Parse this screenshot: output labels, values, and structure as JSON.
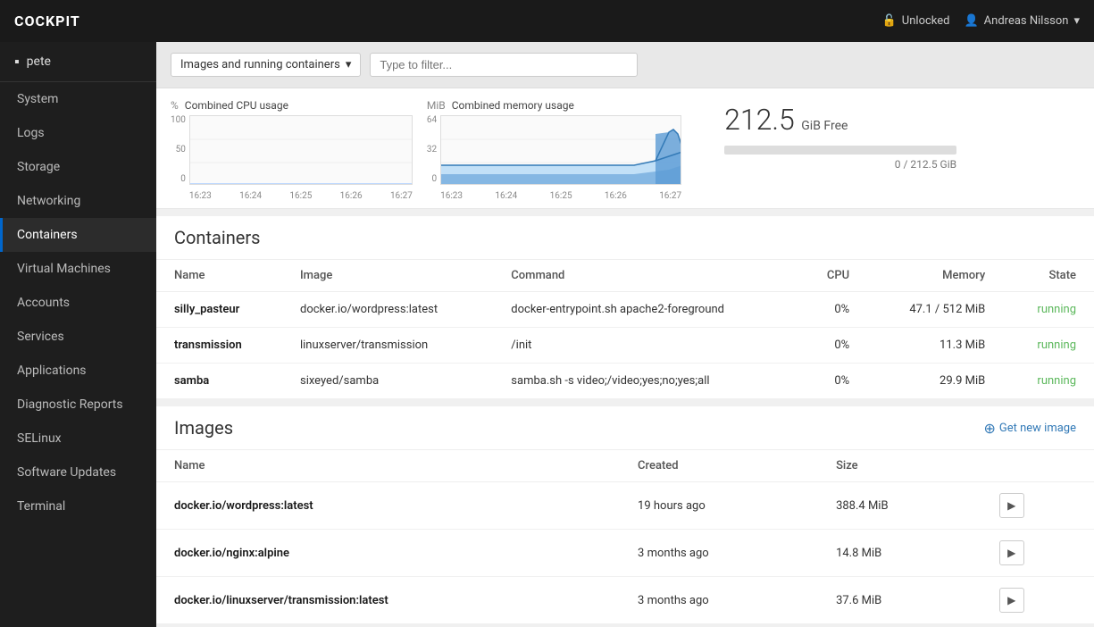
{
  "topbar": {
    "title": "COCKPIT",
    "unlocked_label": "Unlocked",
    "user_label": "Andreas Nilsson",
    "chevron": "▾"
  },
  "sidebar": {
    "host": "pete",
    "items": [
      {
        "id": "system",
        "label": "System",
        "active": false
      },
      {
        "id": "logs",
        "label": "Logs",
        "active": false
      },
      {
        "id": "storage",
        "label": "Storage",
        "active": false
      },
      {
        "id": "networking",
        "label": "Networking",
        "active": false
      },
      {
        "id": "containers",
        "label": "Containers",
        "active": true
      },
      {
        "id": "virtual-machines",
        "label": "Virtual Machines",
        "active": false
      },
      {
        "id": "accounts",
        "label": "Accounts",
        "active": false
      },
      {
        "id": "services",
        "label": "Services",
        "active": false
      },
      {
        "id": "applications",
        "label": "Applications",
        "active": false
      },
      {
        "id": "diagnostic-reports",
        "label": "Diagnostic Reports",
        "active": false
      },
      {
        "id": "selinux",
        "label": "SELinux",
        "active": false
      },
      {
        "id": "software-updates",
        "label": "Software Updates",
        "active": false
      },
      {
        "id": "terminal",
        "label": "Terminal",
        "active": false
      }
    ]
  },
  "filter": {
    "dropdown_label": "Images and running containers",
    "input_placeholder": "Type to filter..."
  },
  "cpu_chart": {
    "title": "Combined CPU usage",
    "unit": "%",
    "y_labels": [
      "100",
      "50",
      "0"
    ],
    "x_labels": [
      "16:23",
      "16:24",
      "16:25",
      "16:26",
      "16:27"
    ]
  },
  "memory_chart": {
    "title": "Combined memory usage",
    "unit": "MiB",
    "y_labels": [
      "64",
      "32",
      "0"
    ],
    "x_labels": [
      "16:23",
      "16:24",
      "16:25",
      "16:26",
      "16:27"
    ]
  },
  "storage": {
    "value": "212.5",
    "unit": "GiB Free",
    "bar_used": "0 / 212.5 GiB",
    "bar_percent": 0
  },
  "containers_section": {
    "title": "Containers",
    "columns": [
      "Name",
      "Image",
      "Command",
      "CPU",
      "Memory",
      "State"
    ],
    "rows": [
      {
        "name": "silly_pasteur",
        "image": "docker.io/wordpress:latest",
        "command": "docker-entrypoint.sh apache2-foreground",
        "cpu": "0%",
        "memory": "47.1 / 512 MiB",
        "state": "running"
      },
      {
        "name": "transmission",
        "image": "linuxserver/transmission",
        "command": "/init",
        "cpu": "0%",
        "memory": "11.3 MiB",
        "state": "running"
      },
      {
        "name": "samba",
        "image": "sixeyed/samba",
        "command": "samba.sh -s video;/video;yes;no;yes;all",
        "cpu": "0%",
        "memory": "29.9 MiB",
        "state": "running"
      }
    ]
  },
  "images_section": {
    "title": "Images",
    "get_new_label": "Get new image",
    "columns": [
      "Name",
      "Created",
      "Size"
    ],
    "rows": [
      {
        "name": "docker.io/wordpress:latest",
        "created": "19 hours ago",
        "size": "388.4 MiB"
      },
      {
        "name": "docker.io/nginx:alpine",
        "created": "3 months ago",
        "size": "14.8 MiB"
      },
      {
        "name": "docker.io/linuxserver/transmission:latest",
        "created": "3 months ago",
        "size": "37.6 MiB"
      }
    ]
  }
}
